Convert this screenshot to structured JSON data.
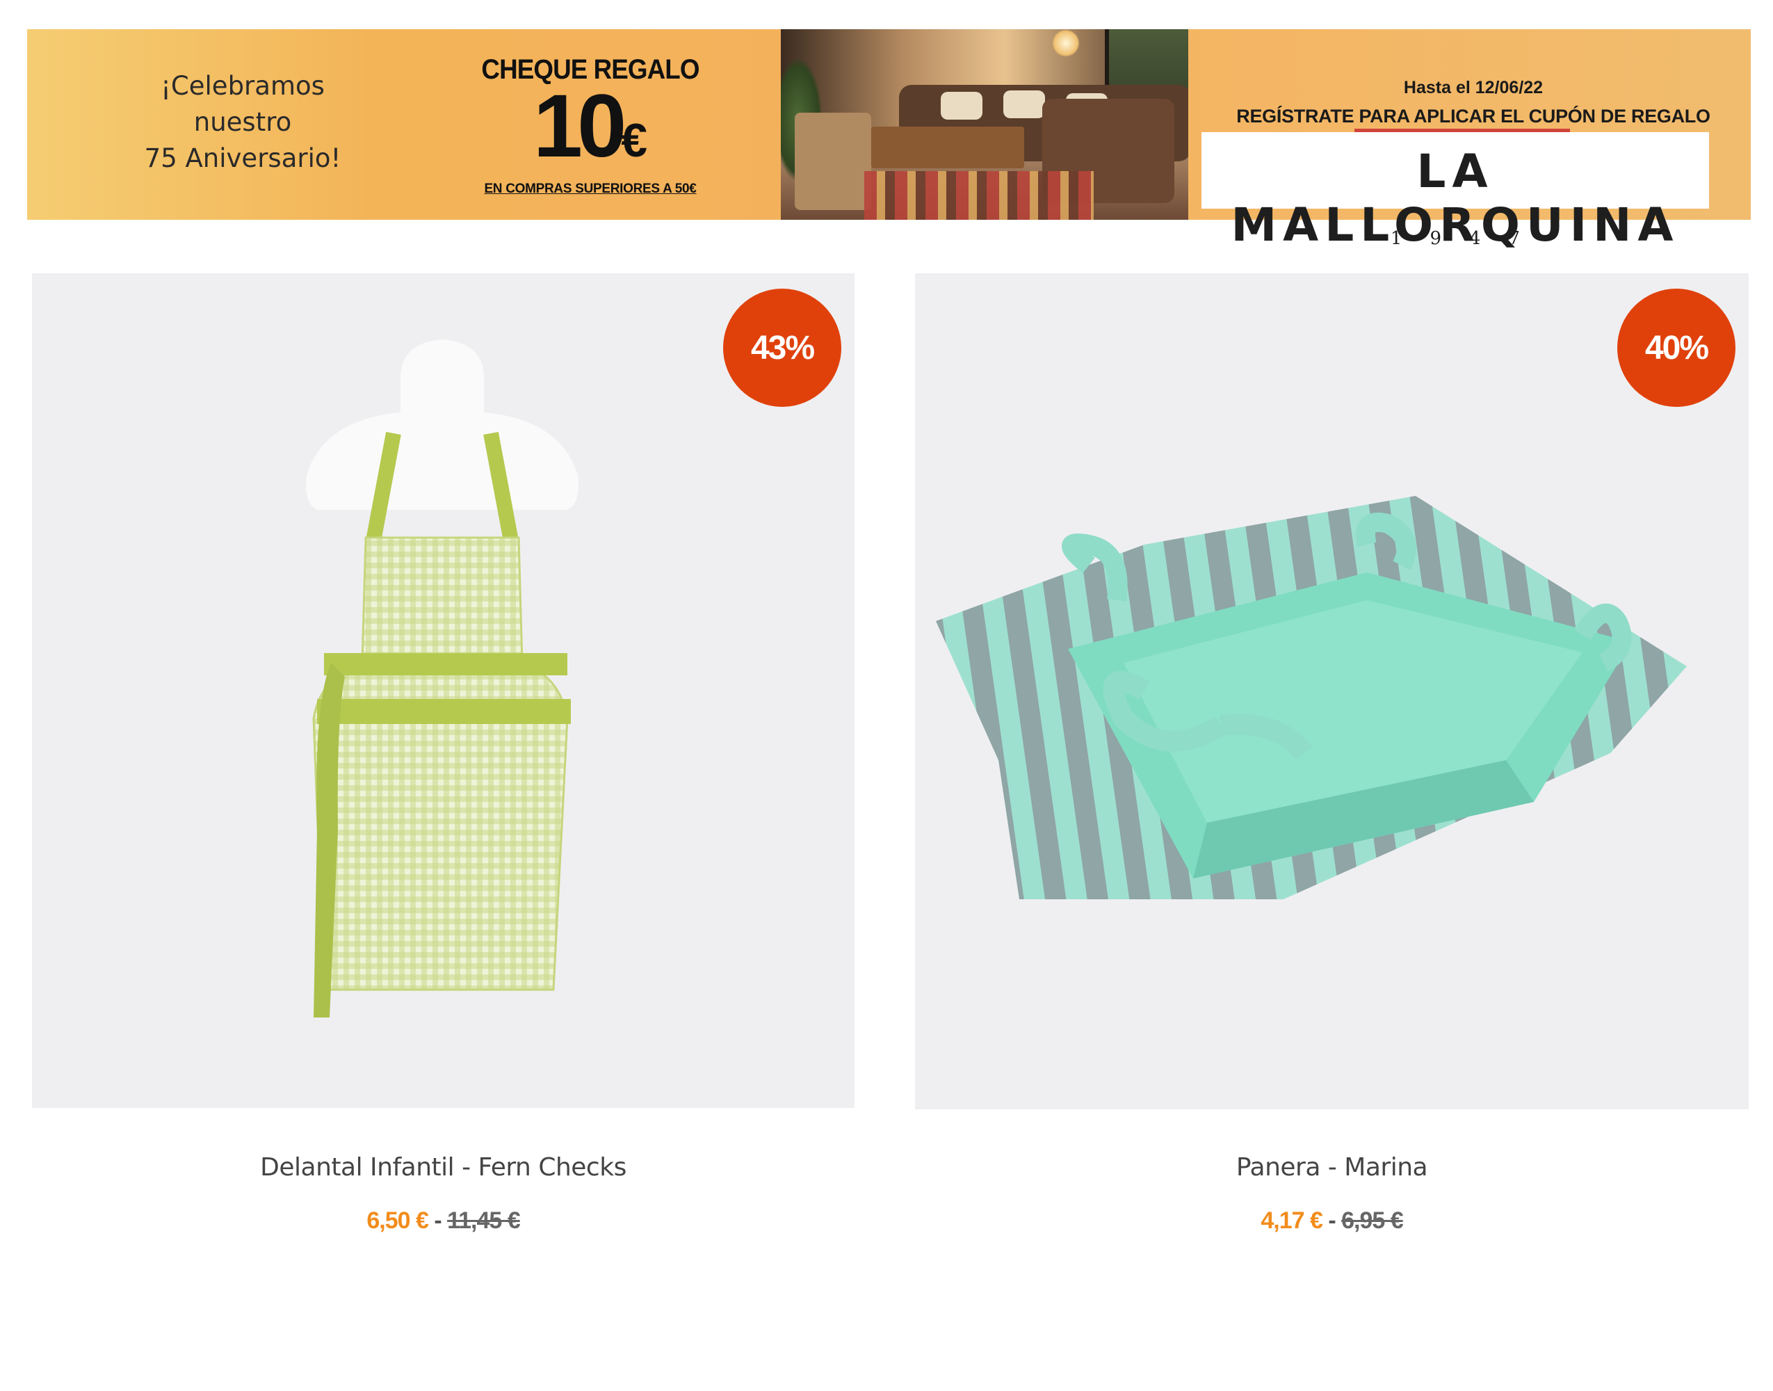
{
  "banner": {
    "anniversary_text": "¡Celebramos\nnuestro\n75 Aniversario!",
    "cheque_title": "CHEQUE REGALO",
    "cheque_amount": "10",
    "cheque_currency": "€",
    "cheque_condition": "EN COMPRAS SUPERIORES A 50€",
    "promo_date": "Hasta el 12/06/22",
    "promo_cta": "REGÍSTRATE PARA APLICAR EL CUPÓN DE REGALO",
    "brand_name": "LA MALLORQUINA",
    "brand_year": "1947"
  },
  "products": [
    {
      "name": "Delantal Infantil - Fern Checks",
      "discount": "43%",
      "price_now": "6,50 €",
      "separator": " - ",
      "price_old": "11,45 €",
      "icon": "apron-image"
    },
    {
      "name": "Panera - Marina",
      "discount": "40%",
      "price_now": "4,17 €",
      "separator": " - ",
      "price_old": "6,95 €",
      "icon": "bread-basket-image"
    }
  ],
  "colors": {
    "banner_orange": "#f4b15c",
    "discount_badge": "#e0410b",
    "sale_price": "#f28c1c"
  }
}
